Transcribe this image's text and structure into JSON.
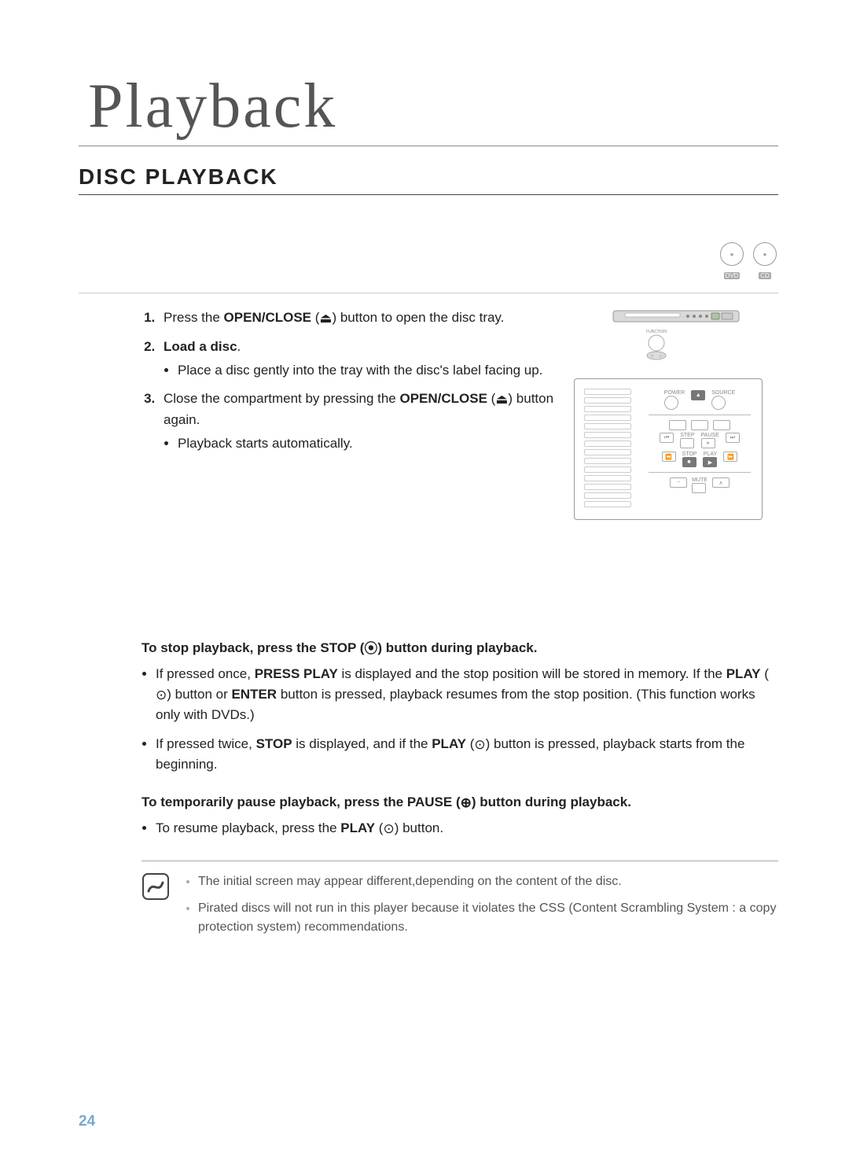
{
  "page_number": "24",
  "chapter_title": "Playback",
  "section_title": "DISC PLAYBACK",
  "badges": [
    {
      "label": "DVD"
    },
    {
      "label": "CD"
    }
  ],
  "steps": {
    "s1": {
      "prefix": "Press the ",
      "bold": "OPEN/CLOSE",
      "suffix1": " (",
      "icon": "⏏",
      "suffix2": ") button to open the disc tray."
    },
    "s2": {
      "bold": "Load a disc",
      "suffix": ".",
      "bullet": "Place a disc gently into the tray with the disc's label facing up."
    },
    "s3": {
      "prefix": "Close the compartment by pressing the ",
      "bold": "OPEN/CLOSE",
      "suffix1": " (",
      "icon": "⏏",
      "suffix2": ") button again.",
      "bullet": "Playback starts automatically."
    }
  },
  "stop_heading": {
    "prefix": "To stop playback, press the ",
    "bold": "STOP",
    "suffix1": " (",
    "icon": "⦿",
    "suffix2": ") button during playback."
  },
  "stop_bullets": {
    "b1_prefix": "If pressed once, ",
    "b1_bold": "PRESS PLAY",
    "b1_mid": " is displayed and the stop position will be stored in memory. If the ",
    "b1_bold2": "PLAY",
    "b1_mid2": " (",
    "b1_icon": "⊙",
    "b1_mid3": ") button or ",
    "b1_bold3": "ENTER",
    "b1_suffix": " button is pressed, playback resumes from the stop position. (This function works only with DVDs.)",
    "b2_prefix": "If pressed twice, ",
    "b2_bold": "STOP",
    "b2_mid": " is displayed, and if the ",
    "b2_bold2": "PLAY",
    "b2_mid2": " (",
    "b2_icon": "⊙",
    "b2_suffix": ") button is pressed, playback starts from the beginning."
  },
  "pause_heading": {
    "prefix": "To temporarily pause playback, press the ",
    "bold": "PAUSE",
    "suffix1": " (",
    "icon": "⊕",
    "suffix2": ") button during playback."
  },
  "pause_bullets": {
    "b1_prefix": "To resume playback, press the ",
    "b1_bold": "PLAY",
    "b1_suffix1": " (",
    "b1_icon": "⊙",
    "b1_suffix2": ") button."
  },
  "notes": {
    "n1": "The initial screen may appear different,depending on the content of the disc.",
    "n2": "Pirated discs will not run in this player because it violates the CSS (Content Scrambling System : a copy protection system) recommendations."
  },
  "remote_panel": {
    "power_label": "POWER",
    "source_label": "SOURCE",
    "function_label": "FUNCTION",
    "step_label": "STEP",
    "pause_label": "PAUSE",
    "stop_label": "STOP",
    "play_label": "PLAY",
    "mute_label": "MUTE"
  }
}
